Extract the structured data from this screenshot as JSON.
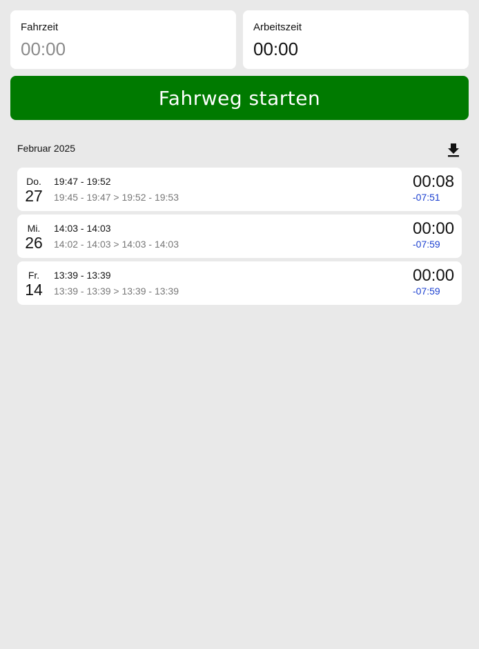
{
  "cards": {
    "drive_label": "Fahrzeit",
    "drive_value": "00:00",
    "work_label": "Arbeitszeit",
    "work_value": "00:00"
  },
  "start_button": {
    "label": "Fahrweg starten",
    "color": "#007a00"
  },
  "month": {
    "title": "Februar 2025",
    "download_icon": "download-icon"
  },
  "entries": [
    {
      "day_name": "Do.",
      "day_num": "27",
      "time_main": "19:47 - 19:52",
      "time_detail": "19:45 - 19:47 > 19:52 - 19:53",
      "duration": "00:08",
      "delta": "-07:51"
    },
    {
      "day_name": "Mi.",
      "day_num": "26",
      "time_main": "14:03 - 14:03",
      "time_detail": "14:02 - 14:03 > 14:03 - 14:03",
      "duration": "00:00",
      "delta": "-07:59"
    },
    {
      "day_name": "Fr.",
      "day_num": "14",
      "time_main": "13:39 - 13:39",
      "time_detail": "13:39 - 13:39 > 13:39 - 13:39",
      "duration": "00:00",
      "delta": "-07:59"
    }
  ],
  "colors": {
    "background": "#e9e9e9",
    "delta": "#1a3fd0"
  }
}
